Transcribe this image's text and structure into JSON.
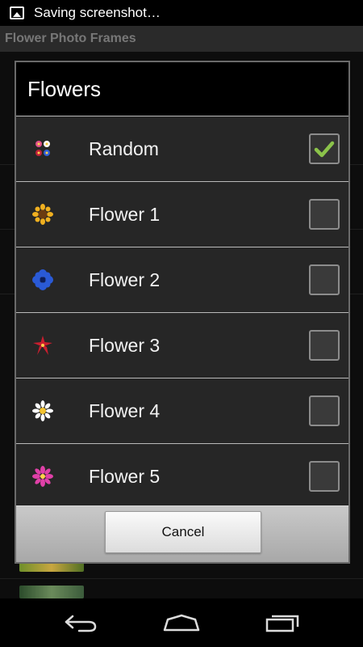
{
  "status_bar": {
    "notification_text": "Saving screenshot…"
  },
  "app": {
    "title": "Flower Photo Frames"
  },
  "dialog": {
    "title": "Flowers",
    "options": [
      {
        "label": "Random",
        "icon": "random-flowers-icon",
        "checked": true
      },
      {
        "label": "Flower 1",
        "icon": "sunflower-icon",
        "checked": false
      },
      {
        "label": "Flower 2",
        "icon": "blue-flower-icon",
        "checked": false
      },
      {
        "label": "Flower 3",
        "icon": "red-lily-icon",
        "checked": false
      },
      {
        "label": "Flower 4",
        "icon": "daisy-icon",
        "checked": false
      },
      {
        "label": "Flower 5",
        "icon": "pink-flower-icon",
        "checked": false
      }
    ],
    "cancel_label": "Cancel"
  },
  "colors": {
    "check_green": "#8bc34a",
    "dialog_bg": "#262626",
    "button_bar": "#b5b5b5"
  },
  "nav": {
    "back": "back-icon",
    "home": "home-icon",
    "recents": "recents-icon"
  }
}
